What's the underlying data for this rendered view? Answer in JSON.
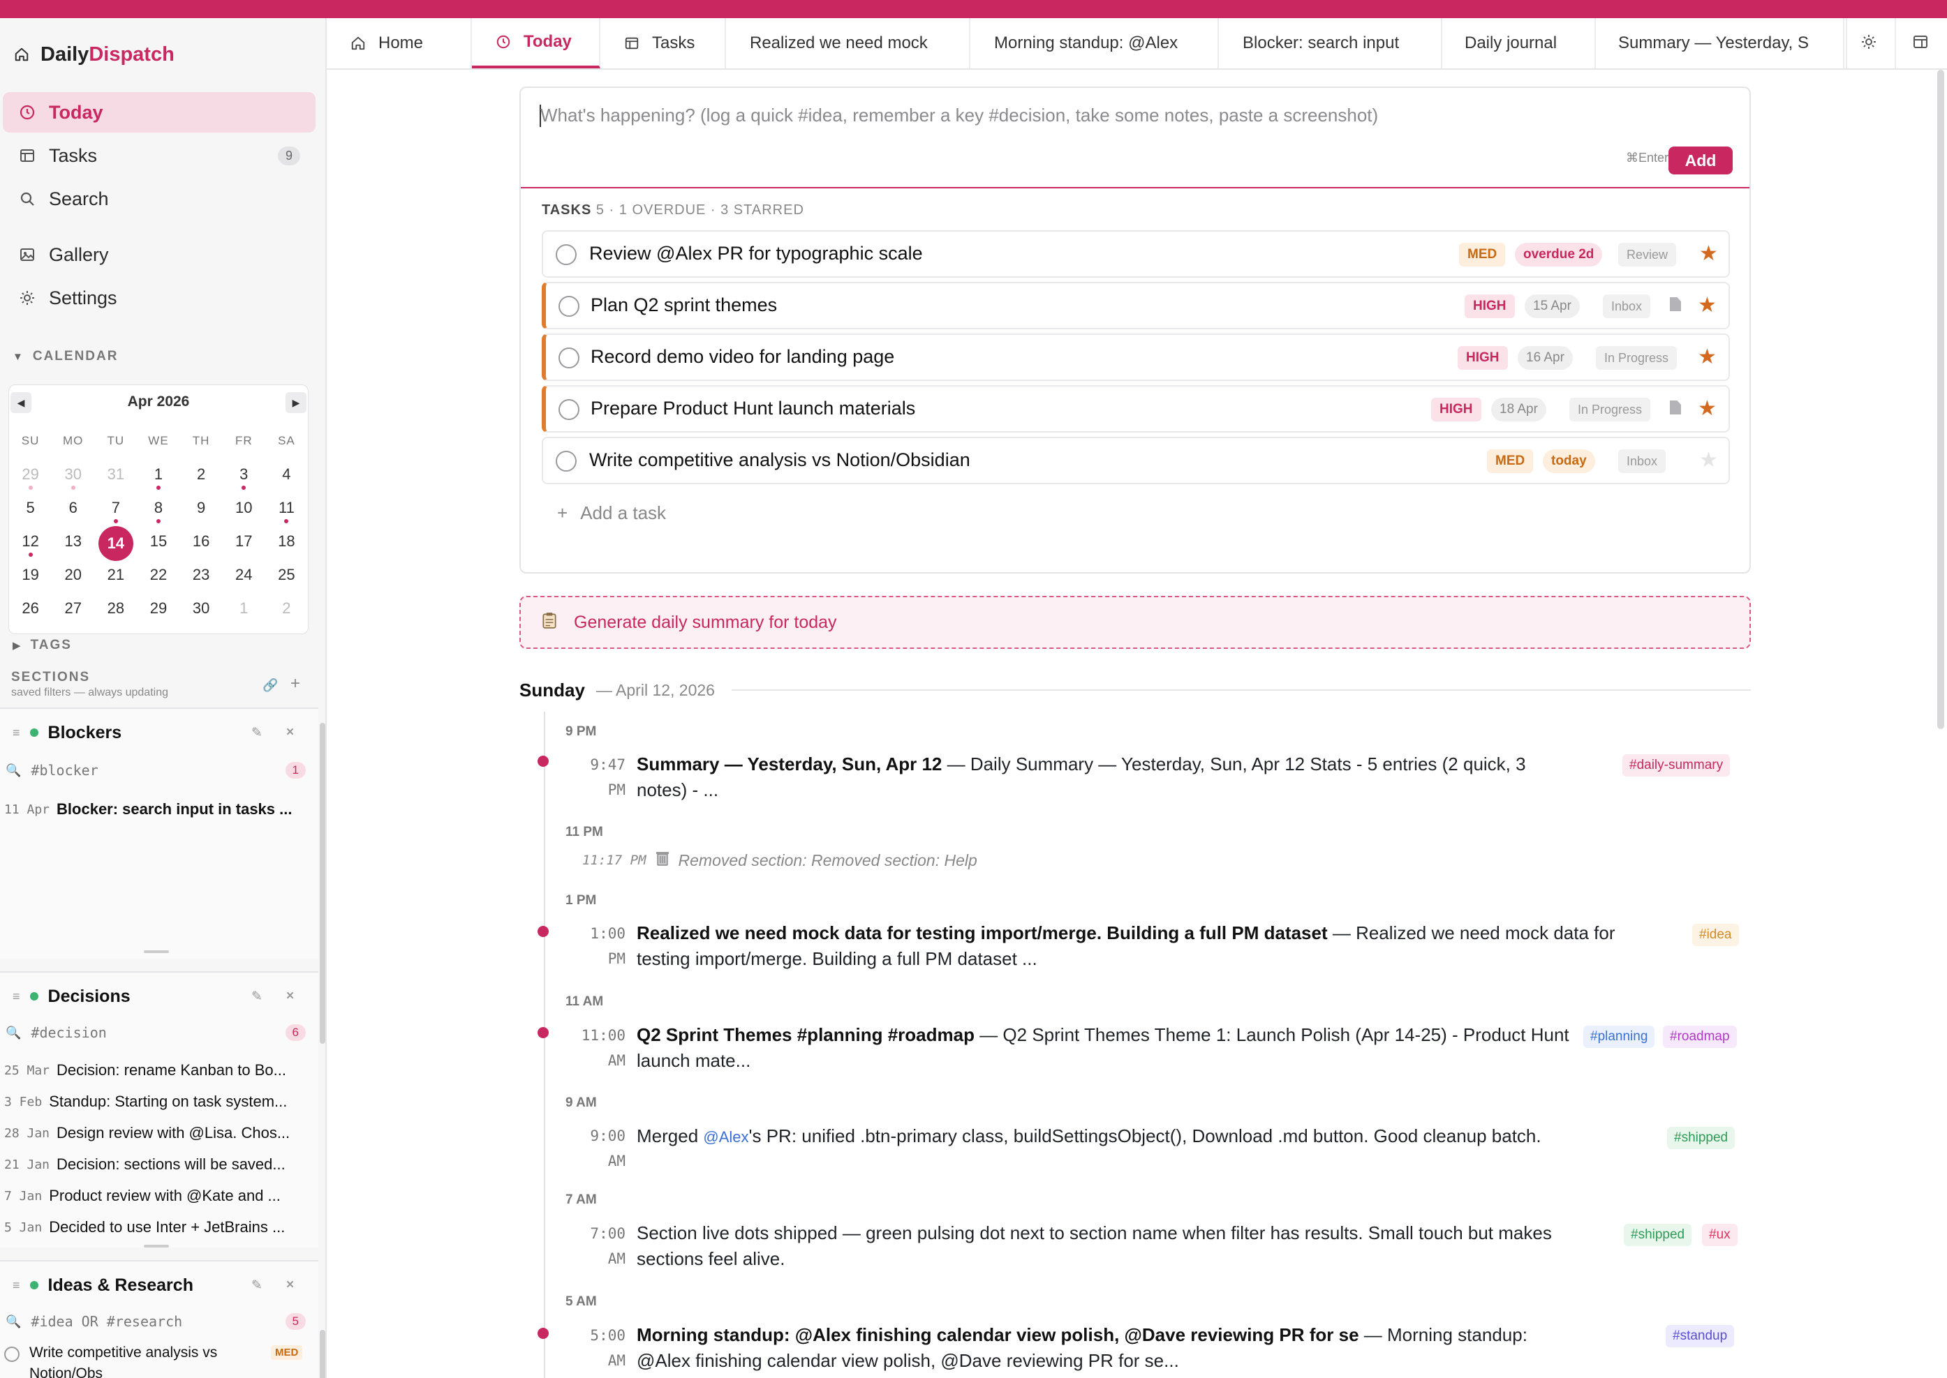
{
  "brand": {
    "prefix": "Daily",
    "accent": "Dispatch"
  },
  "nav": [
    {
      "label": "Today"
    },
    {
      "label": "Tasks",
      "badge": "9"
    },
    {
      "label": "Search"
    },
    {
      "label": "Gallery"
    },
    {
      "label": "Settings"
    }
  ],
  "calendar": {
    "heading": "CALENDAR",
    "month": "Apr 2026",
    "weekdays": [
      "SU",
      "MO",
      "TU",
      "WE",
      "TH",
      "FR",
      "SA"
    ],
    "weeks": [
      [
        "29",
        "30",
        "31",
        "1",
        "2",
        "3",
        "4"
      ],
      [
        "5",
        "6",
        "7",
        "8",
        "9",
        "10",
        "11"
      ],
      [
        "12",
        "13",
        "14",
        "15",
        "16",
        "17",
        "18"
      ],
      [
        "19",
        "20",
        "21",
        "22",
        "23",
        "24",
        "25"
      ],
      [
        "26",
        "27",
        "28",
        "29",
        "30",
        "1",
        "2"
      ]
    ],
    "selected": "14"
  },
  "tags_heading": "TAGS",
  "sections": {
    "heading": "SECTIONS",
    "subtitle": "saved filters — always updating",
    "list": [
      {
        "name": "Blockers",
        "query": "#blocker",
        "count": "1",
        "rows": [
          {
            "date": "11 Apr",
            "text": "Blocker: search input in tasks ..."
          }
        ]
      },
      {
        "name": "Decisions",
        "query": "#decision",
        "count": "6",
        "rows": [
          {
            "date": "25 Mar",
            "text": "Decision: rename Kanban to Bo..."
          },
          {
            "date": "3 Feb",
            "text": "Standup: Starting on task system..."
          },
          {
            "date": "28 Jan",
            "text": "Design review with @Lisa. Chos..."
          },
          {
            "date": "21 Jan",
            "text": "Decision: sections will be saved..."
          },
          {
            "date": "7 Jan",
            "text": "Product review with @Kate and ..."
          },
          {
            "date": "5 Jan",
            "text": "Decided to use Inter + JetBrains ..."
          }
        ]
      },
      {
        "name": "Ideas & Research",
        "query": "#idea OR #research",
        "count": "5",
        "rows": [
          {
            "text": "Write competitive analysis vs Notion/Obs",
            "badge": "MED"
          }
        ]
      }
    ]
  },
  "tabs": [
    {
      "label": "Home"
    },
    {
      "label": "Today"
    },
    {
      "label": "Tasks"
    },
    {
      "label": "Realized we need mock"
    },
    {
      "label": "Morning standup: @Alex"
    },
    {
      "label": "Blocker: search input"
    },
    {
      "label": "Daily journal"
    },
    {
      "label": "Summary — Yesterday, S"
    }
  ],
  "composer": {
    "placeholder": "What's happening? (log a quick #idea, remember a key #decision, take some notes, paste a screenshot)",
    "shortcut": "⌘Enter",
    "add": "Add"
  },
  "tasks": {
    "title": "TASKS",
    "summary": "5 · 1 OVERDUE · 3 STARRED",
    "items": [
      {
        "title": "Review @Alex PR for typographic scale",
        "priority": "MED",
        "due": "overdue 2d",
        "status": "Review",
        "starred": true
      },
      {
        "title": "Plan Q2 sprint themes",
        "priority": "HIGH",
        "due": "15 Apr",
        "status": "Inbox",
        "starred": true
      },
      {
        "title": "Record demo video for landing page",
        "priority": "HIGH",
        "due": "16 Apr",
        "status": "In Progress",
        "starred": true
      },
      {
        "title": "Prepare Product Hunt launch materials",
        "priority": "HIGH",
        "due": "18 Apr",
        "status": "In Progress",
        "starred": true
      },
      {
        "title": "Write competitive analysis vs Notion/Obsidian",
        "priority": "MED",
        "due": "today",
        "status": "Inbox",
        "starred": false
      }
    ],
    "add_label": "Add a task"
  },
  "generate_label": "Generate daily summary for today",
  "day": {
    "name": "Sunday",
    "date": "— April 12, 2026"
  },
  "timeline": {
    "hours": [
      "9 PM",
      "11 PM",
      "1 PM",
      "11 AM",
      "9 AM",
      "7 AM",
      "5 AM"
    ],
    "entries": [
      {
        "time": "9:47",
        "ampm": "PM",
        "title": "Summary — Yesterday, Sun, Apr 12",
        "body": " — Daily Summary — Yesterday, Sun, Apr 12 Stats - 5 entries (2 quick, 3 notes) - ...",
        "tags": [
          "#daily-summary"
        ]
      },
      {
        "time": "1:00",
        "ampm": "PM",
        "title": "Realized we need mock data for testing import/merge. Building a full PM dataset",
        "body": " — Realized we need mock data for testing import/merge. Building a full PM dataset ...",
        "tags": [
          "#idea"
        ]
      },
      {
        "time": "11:00",
        "ampm": "AM",
        "title": "Q2 Sprint Themes #planning #roadmap",
        "body": " — Q2 Sprint Themes Theme 1: Launch Polish (Apr 14-25) - Product Hunt launch mate...",
        "tags": [
          "#planning",
          "#roadmap"
        ]
      },
      {
        "time": "9:00",
        "ampm": "AM",
        "pre": "Merged ",
        "mention": "@Alex",
        "body": "'s PR: unified .btn-primary class, buildSettingsObject(), Download .md button. Good cleanup batch.",
        "tags": [
          "#shipped"
        ]
      },
      {
        "time": "7:00",
        "ampm": "AM",
        "body": "Section live dots shipped — green pulsing dot next to section name when filter has results. Small touch but makes sections feel alive.",
        "tags": [
          "#shipped",
          "#ux"
        ]
      },
      {
        "time": "5:00",
        "ampm": "AM",
        "title": "Morning standup: @Alex finishing calendar view polish, @Dave reviewing PR for se",
        "body": " — Morning standup: @Alex finishing calendar view polish, @Dave reviewing PR for se...",
        "tags": [
          "#standup"
        ]
      }
    ],
    "removed": {
      "time": "11:17 PM",
      "text": "Removed section: Removed section: Help"
    }
  }
}
